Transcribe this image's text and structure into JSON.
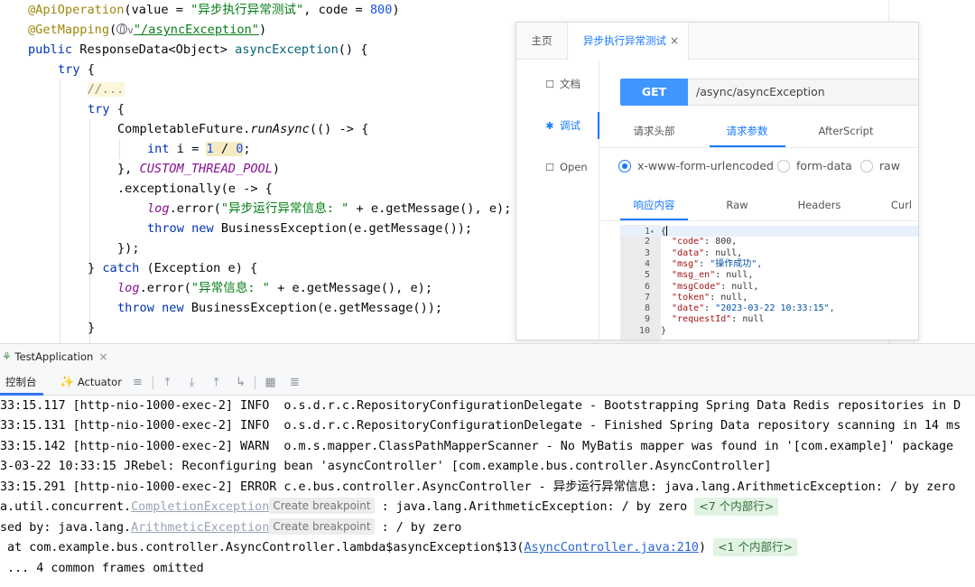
{
  "editor": {
    "ann1": "@ApiOperation",
    "ann1_args_a": "(value = ",
    "ann1_value": "\"异步执行异常测试\"",
    "ann1_args_b": ", code = ",
    "ann1_code": "800",
    "ann1_close": ")",
    "ann2": "@GetMapping",
    "ann2_open": "(",
    "ann2_chevron": "v",
    "ann2_path": "\"/asyncException\"",
    "ann2_close": ")",
    "kw_public": "public",
    "sig_type": " ResponseData<Object> ",
    "sig_method": "asyncException",
    "sig_rest": "() {",
    "kw_try": "try",
    "brace_open": " {",
    "comment": "//...",
    "future_call": "CompletableFuture.",
    "run_async": "runAsync",
    "lambda_open": "(() -> {",
    "kw_int": "int",
    "var_decl": " i = ",
    "num_one": "1",
    "div": " / ",
    "num_zero": "0",
    "semi": ";",
    "close_pool_a": "}, ",
    "pool_name": "CUSTOM_THREAD_POOL",
    "close_pool_b": ")",
    "exceptionally": ".exceptionally(e -> {",
    "log_field": "log",
    "error_call": ".error(",
    "log_msg1": "\"异步运行异常信息: \"",
    "log_args1": " + e.getMessage(), e);",
    "kw_throw": "throw",
    "kw_new": "new",
    "throw_rest": " BusinessException(e.getMessage());",
    "lambda_close": "});",
    "catch_close": "} ",
    "kw_catch": "catch",
    "catch_rest": " (Exception e) {",
    "log_msg2": "\"异常信息: \"",
    "log_args2": " + e.getMessage(), e);",
    "brace_close": "}"
  },
  "api_panel": {
    "tab_home": "主页",
    "tab_active": "异步执行异常测试",
    "tab_close": "×",
    "side": [
      {
        "icon": "☐",
        "label": "文档"
      },
      {
        "icon": "✱",
        "label": "调试"
      },
      {
        "icon": "☐",
        "label": "Open"
      }
    ],
    "method": "GET",
    "url": "/async/asyncException",
    "req_tabs": [
      "请求头部",
      "请求参数",
      "AfterScript"
    ],
    "radios": [
      "x-www-form-urlencoded",
      "form-data",
      "raw"
    ],
    "resp_tabs": [
      "响应内容",
      "Raw",
      "Headers",
      "Curl"
    ],
    "response_lines": [
      {
        "n": "1",
        "fold": "▾",
        "key": "",
        "val": "{",
        "type": "brace"
      },
      {
        "n": "2",
        "fold": "",
        "key": "\"code\"",
        "val": "800,",
        "type": "plain"
      },
      {
        "n": "3",
        "fold": "",
        "key": "\"data\"",
        "val": "null,",
        "type": "plain"
      },
      {
        "n": "4",
        "fold": "",
        "key": "\"msg\"",
        "val": "\"操作成功\",",
        "type": "str"
      },
      {
        "n": "5",
        "fold": "",
        "key": "\"msg_en\"",
        "val": "null,",
        "type": "plain"
      },
      {
        "n": "6",
        "fold": "",
        "key": "\"msgCode\"",
        "val": "null,",
        "type": "plain"
      },
      {
        "n": "7",
        "fold": "",
        "key": "\"token\"",
        "val": "null,",
        "type": "plain"
      },
      {
        "n": "8",
        "fold": "",
        "key": "\"date\"",
        "val": "\"2023-03-22 10:33:15\",",
        "type": "str"
      },
      {
        "n": "9",
        "fold": "",
        "key": "\"requestId\"",
        "val": "null",
        "type": "plain"
      },
      {
        "n": "10",
        "fold": "",
        "key": "",
        "val": "}",
        "type": "brace"
      }
    ]
  },
  "run": {
    "tab": "TestApplication",
    "tab_close": "×",
    "console_tab": "控制台",
    "actuator_tab": "Actuator",
    "console": {
      "l1": "33:15.117 [http-nio-1000-exec-2] INFO  o.s.d.r.c.RepositoryConfigurationDelegate - Bootstrapping Spring Data Redis repositories in D",
      "l2": "33:15.131 [http-nio-1000-exec-2] INFO  o.s.d.r.c.RepositoryConfigurationDelegate - Finished Spring Data repository scanning in 14 ms",
      "l3": "33:15.142 [http-nio-1000-exec-2] WARN  o.m.s.mapper.ClassPathMapperScanner - No MyBatis mapper was found in '[com.example]' package",
      "l4": "3-03-22 10:33:15 JRebel: Reconfiguring bean 'asyncController' [com.example.bus.controller.AsyncController]",
      "l5": "33:15.291 [http-nio-1000-exec-2] ERROR c.e.bus.controller.AsyncController - 异步运行异常信息: java.lang.ArithmeticException: / by zero",
      "l6_prefix": "a.util.concurrent.",
      "l6_exc": "CompletionException",
      "bp_label": "Create breakpoint",
      "l6_rest": " : java.lang.ArithmeticException: / by zero ",
      "l6_chip": "<7 个内部行>",
      "l7_prefix": "sed by: java.lang.",
      "l7_exc": "ArithmeticException",
      "l7_rest": " : / by zero",
      "l8_prefix": " at com.example.bus.controller.AsyncController.lambda$asyncException$13(",
      "l8_link": "AsyncController.java:210",
      "l8_close": ") ",
      "l8_chip": "<1 个内部行>",
      "l9": " ... 4 common frames omitted"
    }
  }
}
